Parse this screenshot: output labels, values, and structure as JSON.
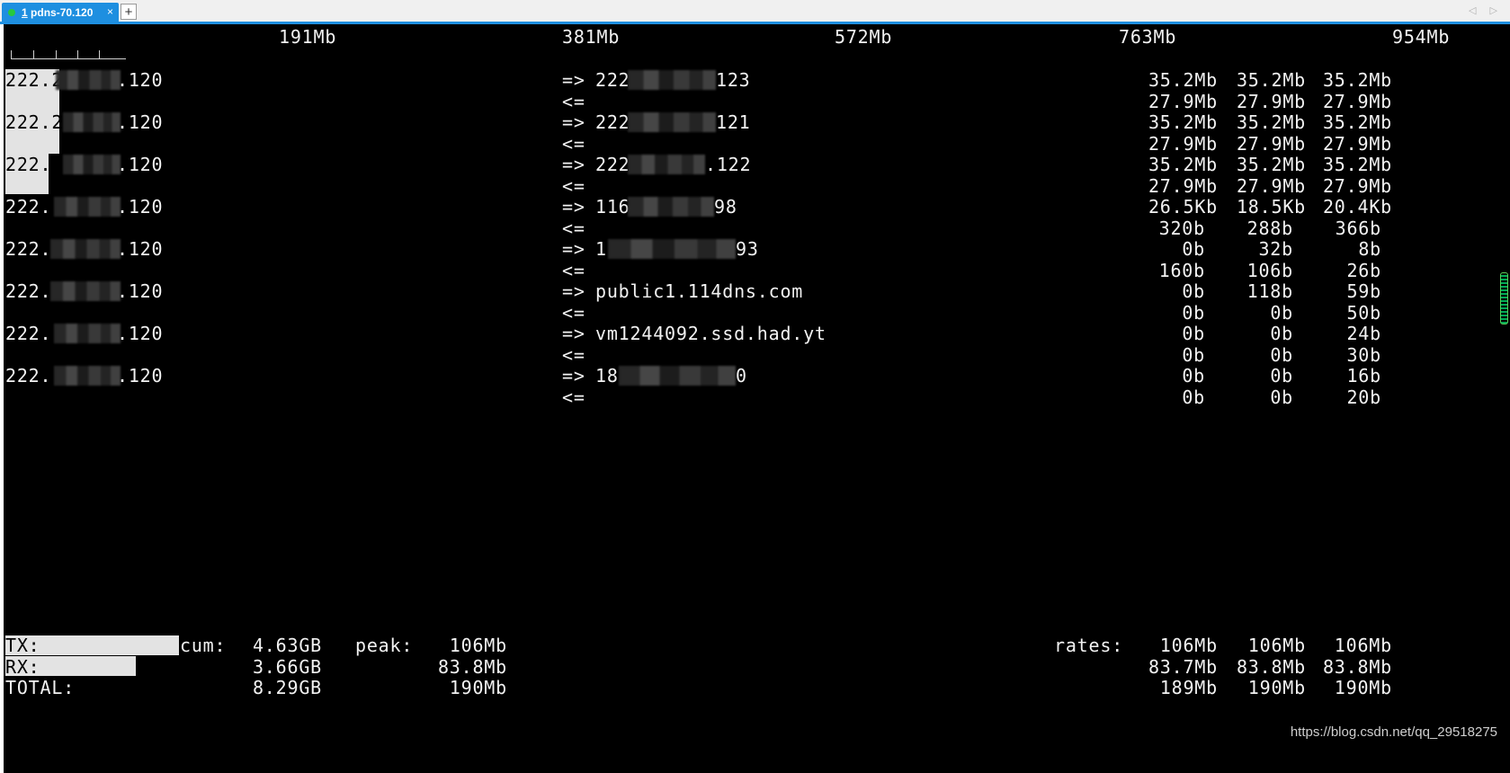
{
  "tab": {
    "index": "1",
    "title": "pdns-70.120",
    "close": "×",
    "new": "+"
  },
  "tabbar_arrows": "◁ ▷",
  "scale": [
    "191Mb",
    "381Mb",
    "572Mb",
    "763Mb",
    "954Mb"
  ],
  "hosts": [
    {
      "local_a": "222.2",
      "local_b": ".120",
      "dir_out": "=>",
      "remote_a": "222",
      "remote_b": "123",
      "dir_in": "<=",
      "out": [
        "35.2Mb",
        "35.2Mb",
        "35.2Mb"
      ],
      "in": [
        "27.9Mb",
        "27.9Mb",
        "27.9Mb"
      ]
    },
    {
      "local_a": "222.2",
      "local_b": ".120",
      "dir_out": "=>",
      "remote_a": "222",
      "remote_b": "121",
      "dir_in": "<=",
      "out": [
        "35.2Mb",
        "35.2Mb",
        "35.2Mb"
      ],
      "in": [
        "27.9Mb",
        "27.9Mb",
        "27.9Mb"
      ]
    },
    {
      "local_a": "222.2",
      "local_b": ".120",
      "dir_out": "=>",
      "remote_a": "222",
      "remote_b": ".122",
      "dir_in": "<=",
      "out": [
        "35.2Mb",
        "35.2Mb",
        "35.2Mb"
      ],
      "in": [
        "27.9Mb",
        "27.9Mb",
        "27.9Mb"
      ]
    },
    {
      "local_a": "222.",
      "local_b": ".120",
      "dir_out": "=>",
      "remote_a": "116",
      "remote_b": "98",
      "dir_in": "<=",
      "out": [
        "26.5Kb",
        "18.5Kb",
        "20.4Kb"
      ],
      "in": [
        "320b",
        "288b",
        "366b"
      ]
    },
    {
      "local_a": "222.",
      "local_b": ".120",
      "dir_out": "=>",
      "remote_a": "1",
      "remote_b": "93",
      "dir_in": "<=",
      "out": [
        "0b",
        "32b",
        "8b"
      ],
      "in": [
        "160b",
        "106b",
        "26b"
      ]
    },
    {
      "local_a": "222.",
      "local_b": ".120",
      "dir_out": "=>",
      "remote_a": "public1.114dns.com",
      "remote_b": "",
      "dir_in": "<=",
      "out": [
        "0b",
        "118b",
        "59b"
      ],
      "in": [
        "0b",
        "0b",
        "50b"
      ]
    },
    {
      "local_a": "222.",
      "local_b": ".120",
      "dir_out": "=>",
      "remote_a": "vm1244092.ssd.had.yt",
      "remote_b": "",
      "dir_in": "<=",
      "out": [
        "0b",
        "0b",
        "24b"
      ],
      "in": [
        "0b",
        "0b",
        "30b"
      ]
    },
    {
      "local_a": "222.",
      "local_b": ".120",
      "dir_out": "=>",
      "remote_a": "18",
      "remote_b": "0",
      "dir_in": "<=",
      "out": [
        "0b",
        "0b",
        "16b"
      ],
      "in": [
        "0b",
        "0b",
        "20b"
      ]
    }
  ],
  "totals": {
    "tx_label": "TX:",
    "rx_label": "RX:",
    "total_label": "TOTAL:",
    "cum_label": "cum:",
    "peak_label": "peak:",
    "rates_label": "rates:",
    "tx_cum": "4.63GB",
    "rx_cum": "3.66GB",
    "total_cum": "8.29GB",
    "tx_peak": "106Mb",
    "rx_peak": "83.8Mb",
    "total_peak": "190Mb",
    "tx_rates": [
      "106Mb",
      "106Mb",
      "106Mb"
    ],
    "rx_rates": [
      "83.7Mb",
      "83.8Mb",
      "83.8Mb"
    ],
    "total_rates": [
      "189Mb",
      "190Mb",
      "190Mb"
    ]
  },
  "watermark": "https://blog.csdn.net/qq_29518275"
}
